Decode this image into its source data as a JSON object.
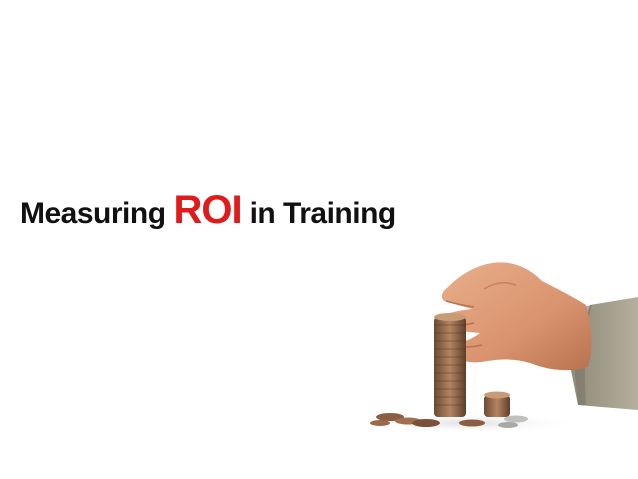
{
  "title": {
    "before": "Measuring",
    "accent": "ROI",
    "after": "in Training",
    "accent_color": "#e01b1b",
    "text_color": "#111111"
  },
  "photo": {
    "subject": "hand-stacking-coins-photo"
  }
}
